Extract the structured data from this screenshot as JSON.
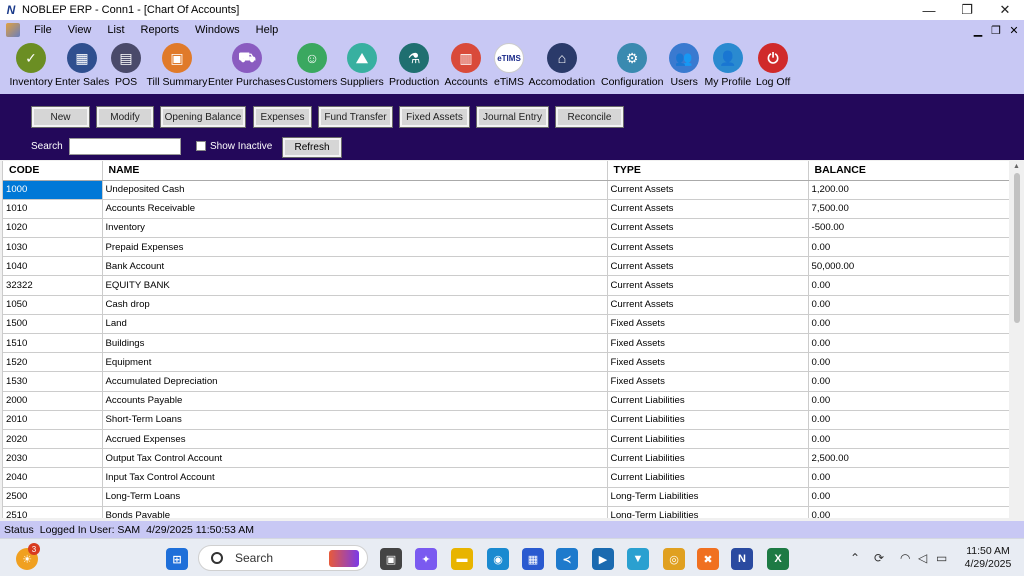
{
  "window": {
    "title": "NOBLEP ERP - Conn1 - [Chart Of Accounts]",
    "app_icon_glyph": "N",
    "minimize_glyph": "—",
    "restore_glyph": "❐",
    "close_glyph": "✕"
  },
  "menu": {
    "items": [
      "File",
      "View",
      "List",
      "Reports",
      "Windows",
      "Help"
    ],
    "mdi_min_glyph": "▁",
    "mdi_restore_glyph": "❐",
    "mdi_close_glyph": "✕"
  },
  "toolbar": {
    "items": [
      {
        "label": "Inventory",
        "icon": "inventory-icon",
        "color": "#6b8e23",
        "glyph": "✓"
      },
      {
        "label": "Enter Sales",
        "icon": "calculator-icon",
        "color": "#2f4f8f",
        "glyph": "▦"
      },
      {
        "label": "POS",
        "icon": "pos-icon",
        "color": "#4a4a6a",
        "glyph": "▤"
      },
      {
        "label": "Till Summary",
        "icon": "till-summary-icon",
        "color": "#e07a2a",
        "glyph": "▣"
      },
      {
        "label": "Enter Purchases",
        "icon": "cart-icon",
        "color": "#8a5cc0",
        "glyph": "⛟"
      },
      {
        "label": "Customers",
        "icon": "customers-icon",
        "color": "#3aa860",
        "glyph": "☺"
      },
      {
        "label": "Suppliers",
        "icon": "suppliers-icon",
        "color": "#38b0a0",
        "glyph": "⛰"
      },
      {
        "label": "Production",
        "icon": "production-icon",
        "color": "#1f6f70",
        "glyph": "⚗"
      },
      {
        "label": "Accounts",
        "icon": "accounts-icon",
        "color": "#d94a3a",
        "glyph": "▥"
      },
      {
        "label": "eTiMS",
        "icon": "etims-icon",
        "color": "#ffffff",
        "glyph": "eTIMS"
      },
      {
        "label": "Accomodation",
        "icon": "accomodation-icon",
        "color": "#2a3a6a",
        "glyph": "⌂"
      },
      {
        "label": "Configuration",
        "icon": "configuration-icon",
        "color": "#3a8ab0",
        "glyph": "⚙"
      },
      {
        "label": "Users",
        "icon": "users-icon",
        "color": "#3a7ad0",
        "glyph": "👥"
      },
      {
        "label": "My Profile",
        "icon": "profile-icon",
        "color": "#2a8ad0",
        "glyph": "👤"
      },
      {
        "label": "Log Off",
        "icon": "logoff-icon",
        "color": "#d02a2a",
        "glyph": "⏻"
      }
    ]
  },
  "actions": {
    "buttons": [
      "New",
      "Modify",
      "Opening Balance",
      "Expenses",
      "Fund Transfer",
      "Fixed Assets",
      "Journal Entry",
      "Reconcile"
    ],
    "search_label": "Search",
    "search_value": "",
    "show_inactive_label": "Show Inactive",
    "refresh_label": "Refresh"
  },
  "grid": {
    "columns": [
      "CODE",
      "NAME",
      "TYPE",
      "BALANCE"
    ],
    "rows": [
      [
        "1000",
        "Undeposited Cash",
        "Current Assets",
        "1,200.00"
      ],
      [
        "1010",
        "Accounts Receivable",
        "Current Assets",
        "7,500.00"
      ],
      [
        "1020",
        "Inventory",
        "Current Assets",
        "-500.00"
      ],
      [
        "1030",
        "Prepaid Expenses",
        "Current Assets",
        "0.00"
      ],
      [
        "1040",
        "Bank Account",
        "Current Assets",
        "50,000.00"
      ],
      [
        "32322",
        "EQUITY BANK",
        "Current Assets",
        "0.00"
      ],
      [
        "1050",
        "Cash drop",
        "Current Assets",
        "0.00"
      ],
      [
        "1500",
        "Land",
        "Fixed Assets",
        "0.00"
      ],
      [
        "1510",
        "Buildings",
        "Fixed Assets",
        "0.00"
      ],
      [
        "1520",
        "Equipment",
        "Fixed Assets",
        "0.00"
      ],
      [
        "1530",
        "Accumulated Depreciation",
        "Fixed Assets",
        "0.00"
      ],
      [
        "2000",
        "Accounts Payable",
        "Current Liabilities",
        "0.00"
      ],
      [
        "2010",
        "Short-Term Loans",
        "Current Liabilities",
        "0.00"
      ],
      [
        "2020",
        "Accrued Expenses",
        "Current Liabilities",
        "0.00"
      ],
      [
        "2030",
        "Output Tax Control Account",
        "Current Liabilities",
        "2,500.00"
      ],
      [
        "2040",
        "Input Tax Control Account",
        "Current Liabilities",
        "0.00"
      ],
      [
        "2500",
        "Long-Term Loans",
        "Long-Term Liabilities",
        "0.00"
      ],
      [
        "2510",
        "Bonds Payable",
        "Long-Term Liabilities",
        "0.00"
      ]
    ]
  },
  "status": {
    "label": "Status",
    "logged_in": "Logged In User: SAM",
    "datetime": "4/29/2025 11:50:53 AM"
  },
  "taskbar": {
    "search_placeholder": "Search",
    "notification_count": "3",
    "clock_time": "11:50 AM",
    "clock_date": "4/29/2025",
    "apps": [
      {
        "name": "start-icon",
        "color": "#1e6fd9",
        "glyph": "⊞"
      },
      {
        "name": "task-view-icon",
        "color": "#444444",
        "glyph": "▣"
      },
      {
        "name": "copilot-icon",
        "color": "#7a5af0",
        "glyph": "✦"
      },
      {
        "name": "file-explorer-icon",
        "color": "#e8b400",
        "glyph": "▬"
      },
      {
        "name": "edge-icon",
        "color": "#1a8ad0",
        "glyph": "◉"
      },
      {
        "name": "store-icon",
        "color": "#2a5ad0",
        "glyph": "▦"
      },
      {
        "name": "vscode-icon",
        "color": "#1e7acc",
        "glyph": "≺"
      },
      {
        "name": "media-player-icon",
        "color": "#1a6ab0",
        "glyph": "▶"
      },
      {
        "name": "vpn-icon",
        "color": "#2aa0d0",
        "glyph": "▼"
      },
      {
        "name": "chrome-icon",
        "color": "#e0a020",
        "glyph": "◎"
      },
      {
        "name": "xampp-icon",
        "color": "#f07020",
        "glyph": "✖"
      },
      {
        "name": "noblep-erp-icon",
        "color": "#2a4aa0",
        "glyph": "N"
      },
      {
        "name": "excel-icon",
        "color": "#1d7a44",
        "glyph": "X"
      }
    ]
  }
}
